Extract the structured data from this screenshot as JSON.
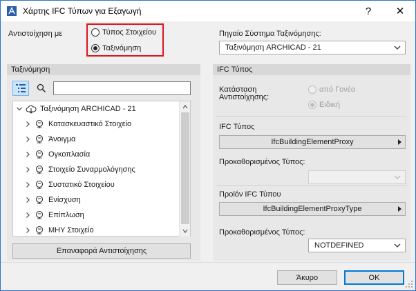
{
  "window": {
    "title": "Χάρτης IFC Τύπων για Εξαγωγή",
    "help_label": "?",
    "close_label": "✕"
  },
  "mapping": {
    "label": "Αντιστοίχηση με",
    "options": [
      {
        "label": "Τύπος Στοιχείου",
        "selected": false
      },
      {
        "label": "Ταξινόμηση",
        "selected": true
      }
    ]
  },
  "source_system": {
    "label": "Πηγαίο Σύστημα Ταξινόμησης:",
    "value": "Ταξινόμηση ARCHICAD - 21"
  },
  "left_panel": {
    "header": "Ταξινόμηση",
    "search_placeholder": "",
    "tree_root": "Ταξινόμηση ARCHICAD - 21",
    "tree_items": [
      "Κατασκευαστικό Στοιχείο",
      "Άνοιγμα",
      "Ογκοπλασία",
      "Στοιχείο Συναρμολόγησης",
      "Συστατικό Στοιχείου",
      "Ενίσχυση",
      "Επίπλωση",
      "ΜΗΥ Στοιχείο"
    ],
    "reset_button": "Επαναφορά Αντιστοίχησης"
  },
  "right_panel": {
    "header": "IFC Τύπος",
    "mapping_state": {
      "label_line1": "Κατάσταση",
      "label_line2": "Αντιστοίχησης:",
      "options": [
        {
          "label": "από Γονέα",
          "selected": false
        },
        {
          "label": "Ειδική",
          "selected": true
        }
      ]
    },
    "ifc_type": {
      "label": "IFC Τύπος",
      "value": "IfcBuildingElementProxy"
    },
    "predefined_type_1": {
      "label": "Προκαθορισμένος Τύπος:",
      "value": ""
    },
    "ifc_product_type": {
      "label": "Προϊόν IFC Τύπου",
      "value": "IfcBuildingElementProxyType"
    },
    "predefined_type_2": {
      "label": "Προκαθορισμένος Τύπος:",
      "value": "NOTDEFINED"
    }
  },
  "footer": {
    "cancel_button": "Άκυρο",
    "ok_button": "OK"
  },
  "colors": {
    "highlight_border": "#e0131b",
    "window_border": "#2b73c9",
    "default_button": "#0078d7"
  }
}
